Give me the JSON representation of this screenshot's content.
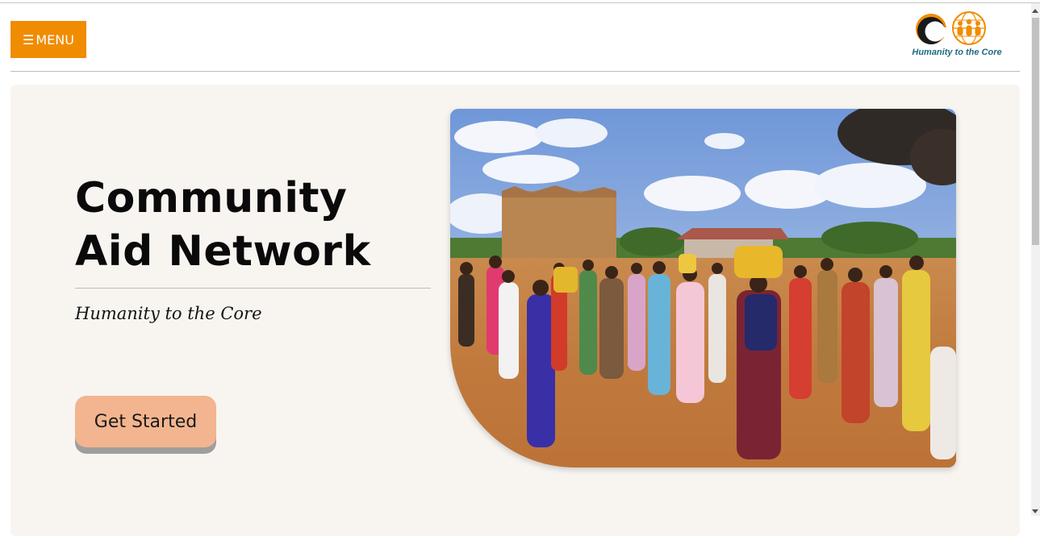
{
  "header": {
    "menu_icon": "hamburger-icon",
    "menu_glyph": "☰",
    "menu_label": "MENU",
    "menu_color": "#f08c00",
    "logo": {
      "icon": "globe-people-icon",
      "letter": "C",
      "tagline": "Humanity to the Core",
      "primary_color": "#f08c00",
      "secondary_color": "#1e6b80"
    }
  },
  "hero": {
    "title": "Community Aid Network",
    "tagline": "Humanity to the Core",
    "cta_label": "Get Started",
    "cta_color": "#f3b58f",
    "image": "photo of women carrying water containers gathered outdoors near a water tank"
  }
}
